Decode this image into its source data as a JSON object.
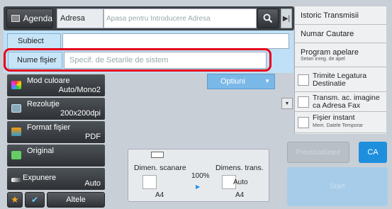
{
  "header": {
    "agenda_label": "Agenda",
    "adresa_label": "Adresa",
    "adresa_placeholder": "Apasa pentru Introducere Adresa"
  },
  "form": {
    "subiect_label": "Subiect",
    "subiect_value": "",
    "nume_fisier_label": "Nume fişier",
    "nume_fisier_placeholder": "Specif. de Setarile de sistem",
    "optiuni_label": "Optiuni"
  },
  "settings": [
    {
      "label": "Mod culoare",
      "value": "Auto/Mono2"
    },
    {
      "label": "Rezoluţie",
      "value": "200x200dpi"
    },
    {
      "label": "Format fişier",
      "value": "PDF"
    },
    {
      "label": "Original",
      "value": ""
    },
    {
      "label": "Expunere",
      "value": "Auto"
    }
  ],
  "bottom_left": {
    "altele_label": "Altele"
  },
  "scan": {
    "dimen_scanare_label": "Dimen. scanare",
    "dimen_trans_label": "Dimens. trans.",
    "ratio": "100%",
    "scan_size": "A4",
    "trans_size": "A4",
    "trans_auto": "Auto"
  },
  "right_panel": {
    "istoric": "Istoric Transmisii",
    "numar_cautare": "Numar Cautare",
    "program_apelare": "Program apelare",
    "program_apelare_sub": "Setari inreg. de apel",
    "checks": [
      {
        "label": "Trimite Legatura Destinatie",
        "sub": "",
        "checked": false
      },
      {
        "label": "Transm. ac. imagine ca Adresa Fax",
        "sub": "",
        "checked": false
      },
      {
        "label": "Fişier instant",
        "sub": "Mem. Datele Temporar",
        "checked": false
      }
    ]
  },
  "actions": {
    "previzualizare_label": "Previzualizare",
    "ca_label": "CA",
    "start_label": "Start"
  },
  "colors": {
    "accent_blue": "#1e8fdd",
    "highlight_red": "#e5001a",
    "form_bg": "#bfe0f6"
  }
}
